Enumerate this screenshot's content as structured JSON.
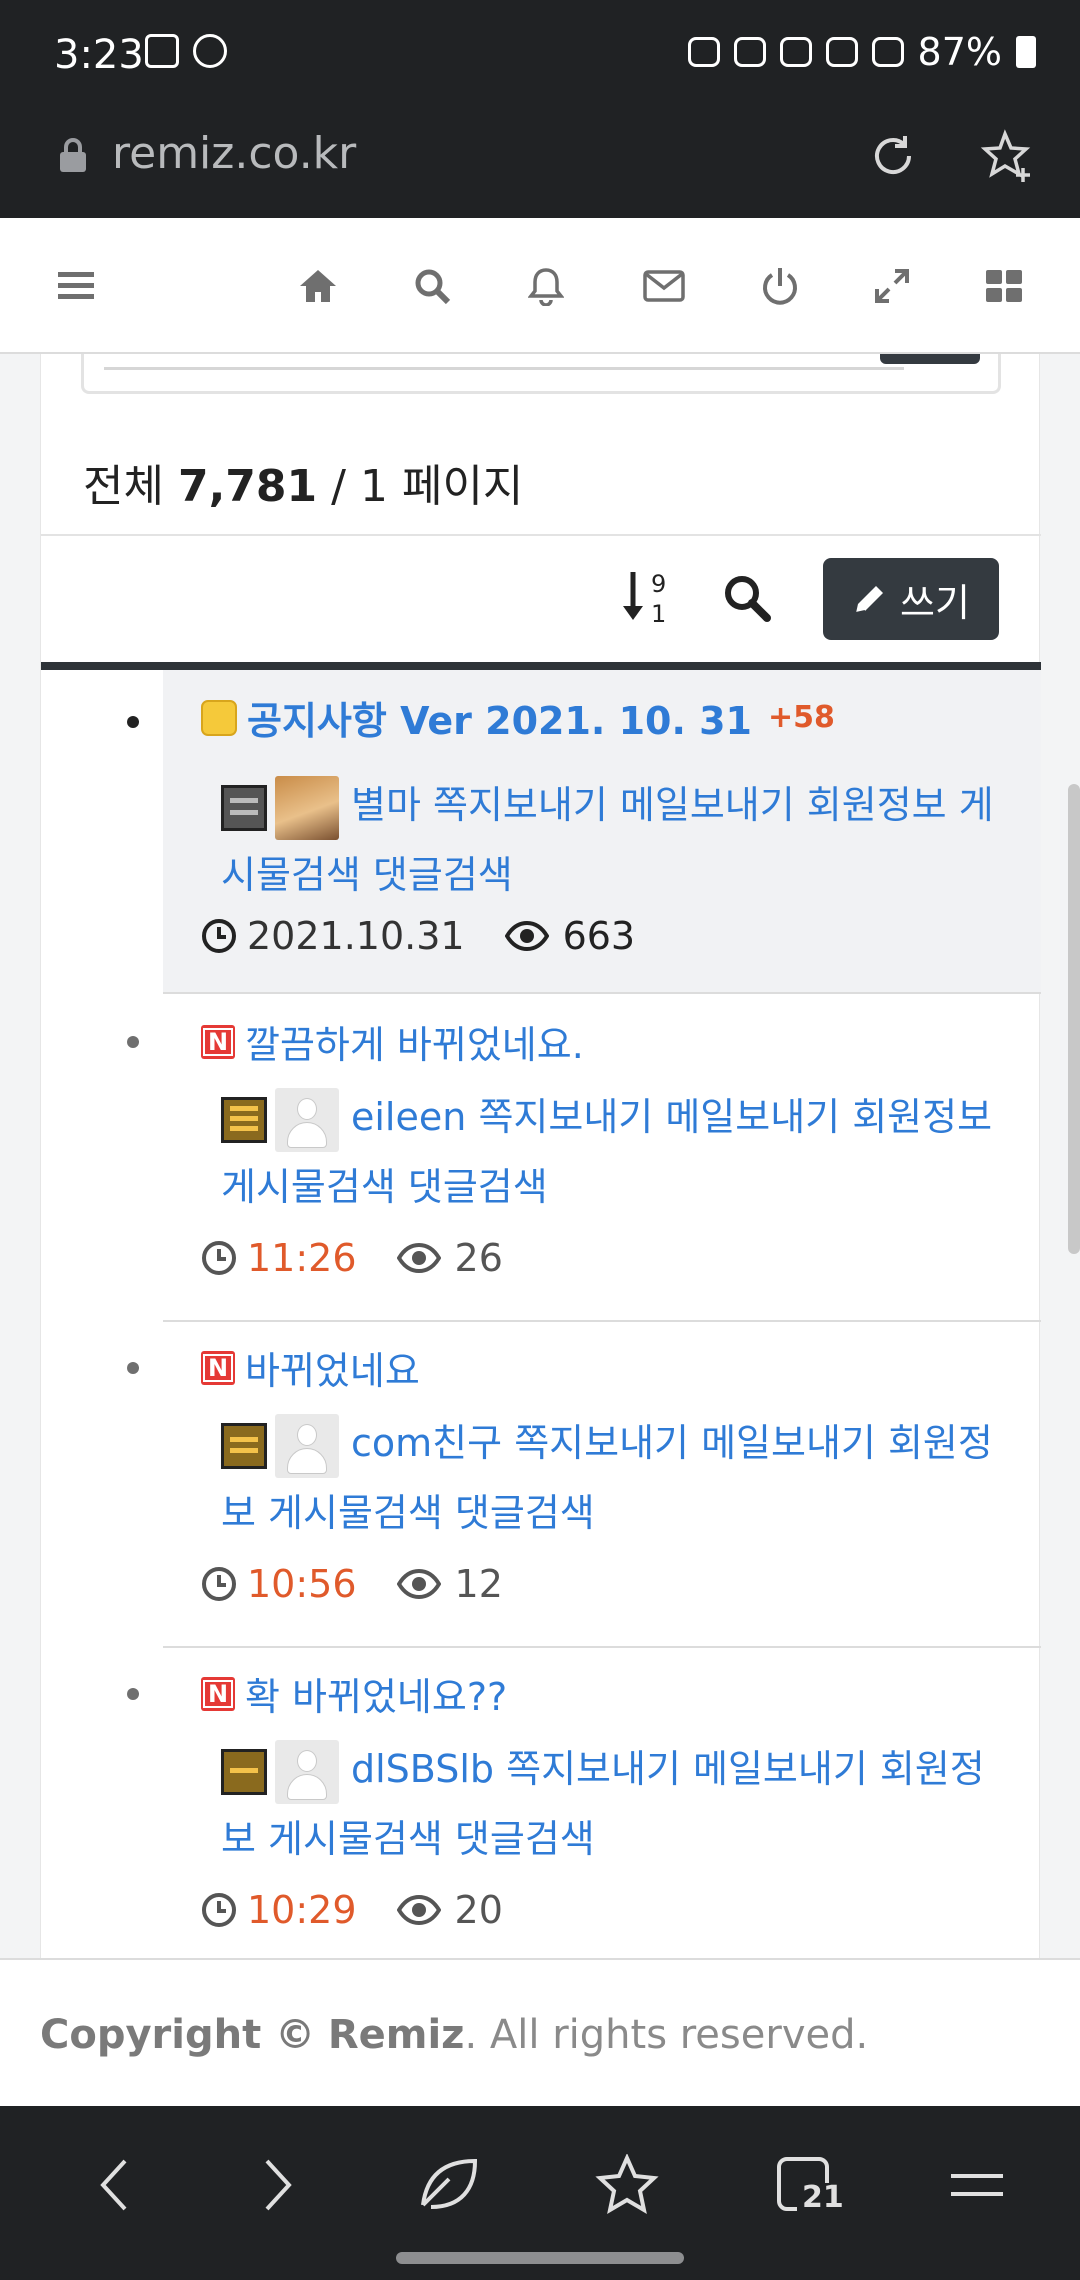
{
  "status_bar": {
    "time": "3:23",
    "battery": "87%"
  },
  "browser": {
    "url": "remiz.co.kr"
  },
  "board": {
    "total_label": "전체",
    "total_count": "7,781",
    "page_sep": "/ 1",
    "page_label": "페이지",
    "sort_label": "9\n1",
    "write_label": "쓰기"
  },
  "posts": [
    {
      "title": "공지사항 Ver 2021. 10. 31",
      "comments": "+58",
      "author": "별마",
      "menu": "쪽지보내기 메일보내기 회원정보 게시물검색 댓글검색",
      "time": "2021.10.31",
      "views": "663"
    },
    {
      "title": "깔끔하게 바뀌었네요.",
      "author": "eileen",
      "menu": "쪽지보내기 메일보내기 회원정보 게시물검색 댓글검색",
      "time": "11:26",
      "views": "26"
    },
    {
      "title": "바뀌었네요",
      "author": "com친구",
      "menu": "쪽지보내기 메일보내기 회원정보 게시물검색 댓글검색",
      "time": "10:56",
      "views": "12"
    },
    {
      "title": "확 바뀌었네요??",
      "author": "dlSBSlb",
      "menu": "쪽지보내기 메일보내기 회원정보 게시물검색 댓글검색",
      "time": "10:29",
      "views": "20"
    }
  ],
  "footer": {
    "prefix": "Copyright ©",
    "brand": "Remiz",
    "suffix": ". All rights reserved."
  },
  "bottom_bar": {
    "tabs_count": "21"
  },
  "colors": {
    "link": "#2f7bd6",
    "recent_time": "#e05a2b",
    "dark": "#343a40"
  }
}
